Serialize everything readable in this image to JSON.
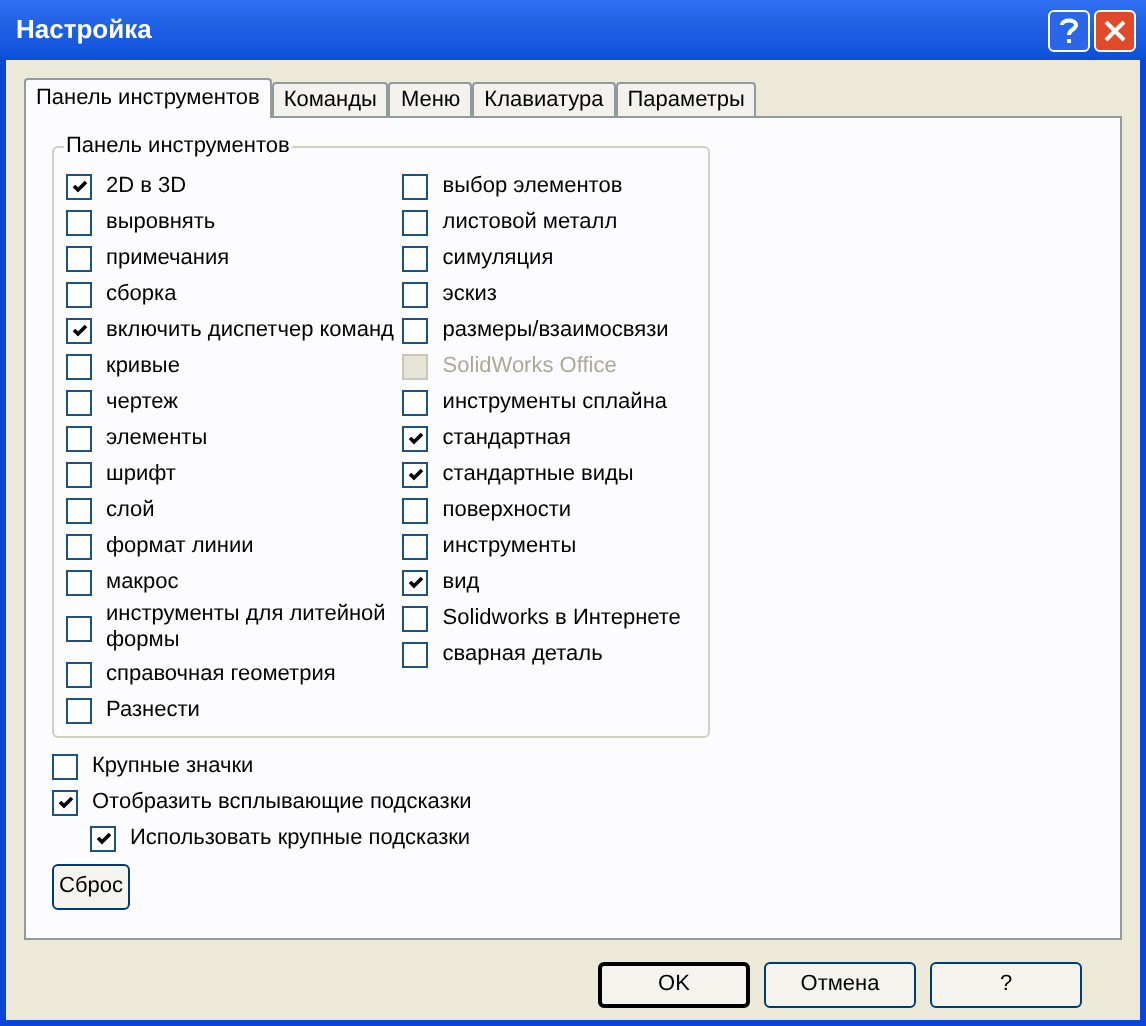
{
  "window": {
    "title": "Настройка"
  },
  "tabs": [
    {
      "label": "Панель инструментов",
      "selected": true
    },
    {
      "label": "Команды",
      "selected": false
    },
    {
      "label": "Меню",
      "selected": false
    },
    {
      "label": "Клавиатура",
      "selected": false
    },
    {
      "label": "Параметры",
      "selected": false
    }
  ],
  "group": {
    "title": "Панель инструментов",
    "columns": [
      [
        {
          "label": "2D в 3D",
          "checked": true,
          "disabled": false
        },
        {
          "label": "выровнять",
          "checked": false,
          "disabled": false
        },
        {
          "label": "примечания",
          "checked": false,
          "disabled": false
        },
        {
          "label": "сборка",
          "checked": false,
          "disabled": false
        },
        {
          "label": "включить диспетчер команд",
          "checked": true,
          "disabled": false
        },
        {
          "label": "кривые",
          "checked": false,
          "disabled": false
        },
        {
          "label": "чертеж",
          "checked": false,
          "disabled": false
        },
        {
          "label": "элементы",
          "checked": false,
          "disabled": false
        },
        {
          "label": "шрифт",
          "checked": false,
          "disabled": false
        },
        {
          "label": "слой",
          "checked": false,
          "disabled": false
        },
        {
          "label": "формат линии",
          "checked": false,
          "disabled": false
        },
        {
          "label": "макрос",
          "checked": false,
          "disabled": false
        },
        {
          "label": "инструменты для литейной формы",
          "checked": false,
          "disabled": false
        },
        {
          "label": "справочная геометрия",
          "checked": false,
          "disabled": false
        },
        {
          "label": "Разнести",
          "checked": false,
          "disabled": false
        }
      ],
      [
        {
          "label": "выбор элементов",
          "checked": false,
          "disabled": false
        },
        {
          "label": "листовой металл",
          "checked": false,
          "disabled": false
        },
        {
          "label": "симуляция",
          "checked": false,
          "disabled": false
        },
        {
          "label": "эскиз",
          "checked": false,
          "disabled": false
        },
        {
          "label": "размеры/взаимосвязи",
          "checked": false,
          "disabled": false
        },
        {
          "label": "SolidWorks Office",
          "checked": false,
          "disabled": true
        },
        {
          "label": "инструменты сплайна",
          "checked": false,
          "disabled": false
        },
        {
          "label": "стандартная",
          "checked": true,
          "disabled": false
        },
        {
          "label": "стандартные виды",
          "checked": true,
          "disabled": false
        },
        {
          "label": "поверхности",
          "checked": false,
          "disabled": false
        },
        {
          "label": "инструменты",
          "checked": false,
          "disabled": false
        },
        {
          "label": "вид",
          "checked": true,
          "disabled": false
        },
        {
          "label": "Solidworks в Интернете",
          "checked": false,
          "disabled": false
        },
        {
          "label": "сварная деталь",
          "checked": false,
          "disabled": false
        }
      ]
    ]
  },
  "options": [
    {
      "label": "Крупные значки",
      "checked": false
    },
    {
      "label": "Отобразить всплывающие подсказки",
      "checked": true,
      "children": [
        {
          "label": "Использовать крупные подсказки",
          "checked": true
        }
      ]
    }
  ],
  "reset_button": "Сброс",
  "buttons": [
    {
      "label": "OK",
      "default": true
    },
    {
      "label": "Отмена",
      "default": false
    },
    {
      "label": "?",
      "default": false
    }
  ]
}
